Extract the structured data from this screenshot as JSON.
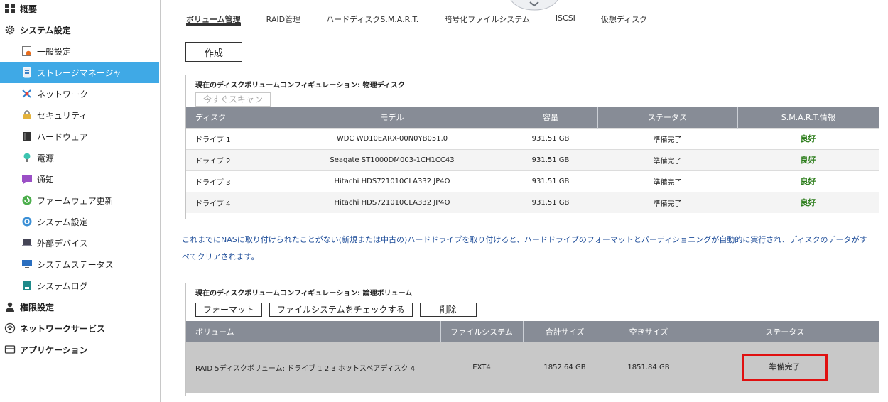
{
  "sidebar": {
    "items": [
      {
        "label": "概要",
        "icon": "grid-icon",
        "level": "top",
        "active": false
      },
      {
        "label": "システム設定",
        "icon": "gear-icon",
        "level": "top",
        "active": false
      },
      {
        "label": "一般設定",
        "icon": "general-settings-icon",
        "level": "sub",
        "active": false
      },
      {
        "label": "ストレージマネージャ",
        "icon": "storage-icon",
        "level": "sub",
        "active": true
      },
      {
        "label": "ネットワーク",
        "icon": "network-icon",
        "level": "sub",
        "active": false
      },
      {
        "label": "セキュリティ",
        "icon": "lock-icon",
        "level": "sub",
        "active": false
      },
      {
        "label": "ハードウェア",
        "icon": "hardware-icon",
        "level": "sub",
        "active": false
      },
      {
        "label": "電源",
        "icon": "power-bulb-icon",
        "level": "sub",
        "active": false
      },
      {
        "label": "通知",
        "icon": "notification-icon",
        "level": "sub",
        "active": false
      },
      {
        "label": "ファームウェア更新",
        "icon": "firmware-update-icon",
        "level": "sub",
        "active": false
      },
      {
        "label": "システム設定",
        "icon": "system-settings-icon",
        "level": "sub",
        "active": false
      },
      {
        "label": "外部デバイス",
        "icon": "external-device-icon",
        "level": "sub",
        "active": false
      },
      {
        "label": "システムステータス",
        "icon": "monitor-icon",
        "level": "sub",
        "active": false
      },
      {
        "label": "システムログ",
        "icon": "log-icon",
        "level": "sub",
        "active": false
      },
      {
        "label": "権限設定",
        "icon": "user-icon",
        "level": "top",
        "active": false
      },
      {
        "label": "ネットワークサービス",
        "icon": "network-service-icon",
        "level": "top",
        "active": false
      },
      {
        "label": "アプリケーション",
        "icon": "applications-icon",
        "level": "top",
        "active": false
      }
    ]
  },
  "tabs": [
    {
      "label": "ボリューム管理",
      "active": true
    },
    {
      "label": "RAID管理",
      "active": false
    },
    {
      "label": "ハードディスクS.M.A.R.T.",
      "active": false
    },
    {
      "label": "暗号化ファイルシステム",
      "active": false
    },
    {
      "label": "iSCSI",
      "active": false
    },
    {
      "label": "仮想ディスク",
      "active": false
    }
  ],
  "create_button": "作成",
  "physical": {
    "title": "現在のディスクボリュームコンフィギュレーション: 物理ディスク",
    "scan_button": "今すぐスキャン",
    "columns": [
      "ディスク",
      "モデル",
      "容量",
      "ステータス",
      "S.M.A.R.T.情報"
    ],
    "rows": [
      {
        "disk": "ドライブ 1",
        "model": "WDC WD10EARX-00N0YB051.0",
        "capacity": "931.51 GB",
        "status": "準備完了",
        "smart": "良好"
      },
      {
        "disk": "ドライブ 2",
        "model": "Seagate ST1000DM003-1CH1CC43",
        "capacity": "931.51 GB",
        "status": "準備完了",
        "smart": "良好"
      },
      {
        "disk": "ドライブ 3",
        "model": "Hitachi HDS721010CLA332 JP4O",
        "capacity": "931.51 GB",
        "status": "準備完了",
        "smart": "良好"
      },
      {
        "disk": "ドライブ 4",
        "model": "Hitachi HDS721010CLA332 JP4O",
        "capacity": "931.51 GB",
        "status": "準備完了",
        "smart": "良好"
      }
    ]
  },
  "note": "これまでにNASに取り付けられたことがない(新規または中古の)ハードドライブを取り付けると、ハードドライブのフォーマットとパーティショニングが自動的に実行され、ディスクのデータがすべてクリアされます。",
  "logical": {
    "title": "現在のディスクボリュームコンフィギュレーション: 論理ボリューム",
    "buttons": {
      "format": "フォーマット",
      "check_fs": "ファイルシステムをチェックする",
      "delete": "削除"
    },
    "columns": [
      "ボリューム",
      "ファイルシステム",
      "合計サイズ",
      "空きサイズ",
      "ステータス"
    ],
    "rows": [
      {
        "volume": "RAID 5ディスクボリューム: ドライブ 1 2 3 ホットスペアディスク 4",
        "fs": "EXT4",
        "total": "1852.64 GB",
        "free": "1851.84 GB",
        "status": "準備完了"
      }
    ]
  },
  "colors": {
    "sidebar_active": "#3fa9e6",
    "table_header": "#878c96",
    "good_status": "#2c7d1b",
    "highlight_box": "#e01010"
  }
}
